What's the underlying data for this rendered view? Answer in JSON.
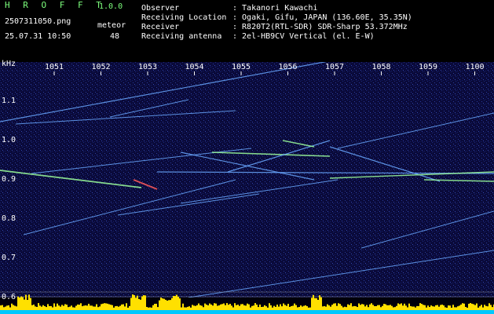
{
  "header": {
    "app_name": "H R O F F T",
    "version": "1.0.0",
    "filename": "2507311050.png",
    "datetime": "25.07.31 10:50",
    "count_label": "meteor",
    "count_value": "48",
    "info": [
      {
        "key": "Observer",
        "value": ": Takanori Kawachi"
      },
      {
        "key": "Receiving Location",
        "value": ": Ogaki, Gifu, JAPAN (136.60E, 35.35N)"
      },
      {
        "key": "Receiver",
        "value": ": R820T2(RTL-SDR) SDR-Sharp 53.372MHz"
      },
      {
        "key": "Receiving antenna",
        "value": ": 2el-HB9CV Vertical (el. E-W)"
      }
    ]
  },
  "axes": {
    "y_unit": "kHz",
    "y_ticks": [
      "1.1",
      "1.0",
      "0.9",
      "0.8",
      "0.7",
      "0.6"
    ],
    "x_ticks": [
      "1051",
      "1052",
      "1053",
      "1054",
      "1055",
      "1056",
      "1057",
      "1058",
      "1059",
      "1100"
    ]
  },
  "colors": {
    "background": "#000000",
    "spectrum_bg": "#0a0a3a",
    "trace": "#6aa8ff",
    "meteor_green": "#9cff9c",
    "meteor_red": "#ff5a5a",
    "level_bars": "#ffe000",
    "level_base": "#00c8ff"
  }
}
